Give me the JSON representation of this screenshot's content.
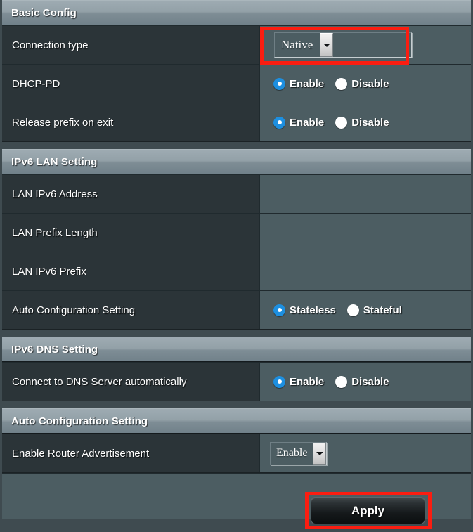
{
  "theme": {
    "page_bg": "#3f4b50",
    "label_cell_bg": "#2b3438",
    "value_cell_bg": "#4c5d62",
    "header_gradient_top": "#9eabb2",
    "header_gradient_bottom": "#71818a",
    "radio_selected_color": "#1d8fe0",
    "radio_unselected_color": "#ffffff",
    "highlight_color": "#fb1d11",
    "text_color": "#ffffff"
  },
  "sections": [
    {
      "id": "basic-config",
      "title": "Basic Config",
      "rows": [
        {
          "id": "connection-type",
          "label": "Connection type",
          "control": "select",
          "value": "Native",
          "highlighted": true
        },
        {
          "id": "dhcp-pd",
          "label": "DHCP-PD",
          "control": "radio",
          "options": [
            "Enable",
            "Disable"
          ],
          "selected": "Enable"
        },
        {
          "id": "release-prefix-on-exit",
          "label": "Release prefix on exit",
          "control": "radio",
          "options": [
            "Enable",
            "Disable"
          ],
          "selected": "Enable"
        }
      ]
    },
    {
      "id": "ipv6-lan-setting",
      "title": "IPv6 LAN Setting",
      "rows": [
        {
          "id": "lan-ipv6-address",
          "label": "LAN IPv6 Address",
          "control": "empty",
          "value": ""
        },
        {
          "id": "lan-prefix-length",
          "label": "LAN Prefix Length",
          "control": "empty",
          "value": ""
        },
        {
          "id": "lan-ipv6-prefix",
          "label": "LAN IPv6 Prefix",
          "control": "empty",
          "value": ""
        },
        {
          "id": "auto-configuration-setting",
          "label": "Auto Configuration Setting",
          "control": "radio",
          "options": [
            "Stateless",
            "Stateful"
          ],
          "selected": "Stateless"
        }
      ]
    },
    {
      "id": "ipv6-dns-setting",
      "title": "IPv6 DNS Setting",
      "rows": [
        {
          "id": "connect-to-dns-server-automatically",
          "label": "Connect to DNS Server automatically",
          "control": "radio",
          "options": [
            "Enable",
            "Disable"
          ],
          "selected": "Enable"
        }
      ]
    },
    {
      "id": "auto-configuration-setting-section",
      "title": "Auto Configuration Setting",
      "rows": [
        {
          "id": "enable-router-advertisement",
          "label": "Enable Router Advertisement",
          "control": "select-small",
          "value": "Enable"
        }
      ]
    }
  ],
  "footer": {
    "apply_label": "Apply",
    "apply_highlighted": true
  }
}
